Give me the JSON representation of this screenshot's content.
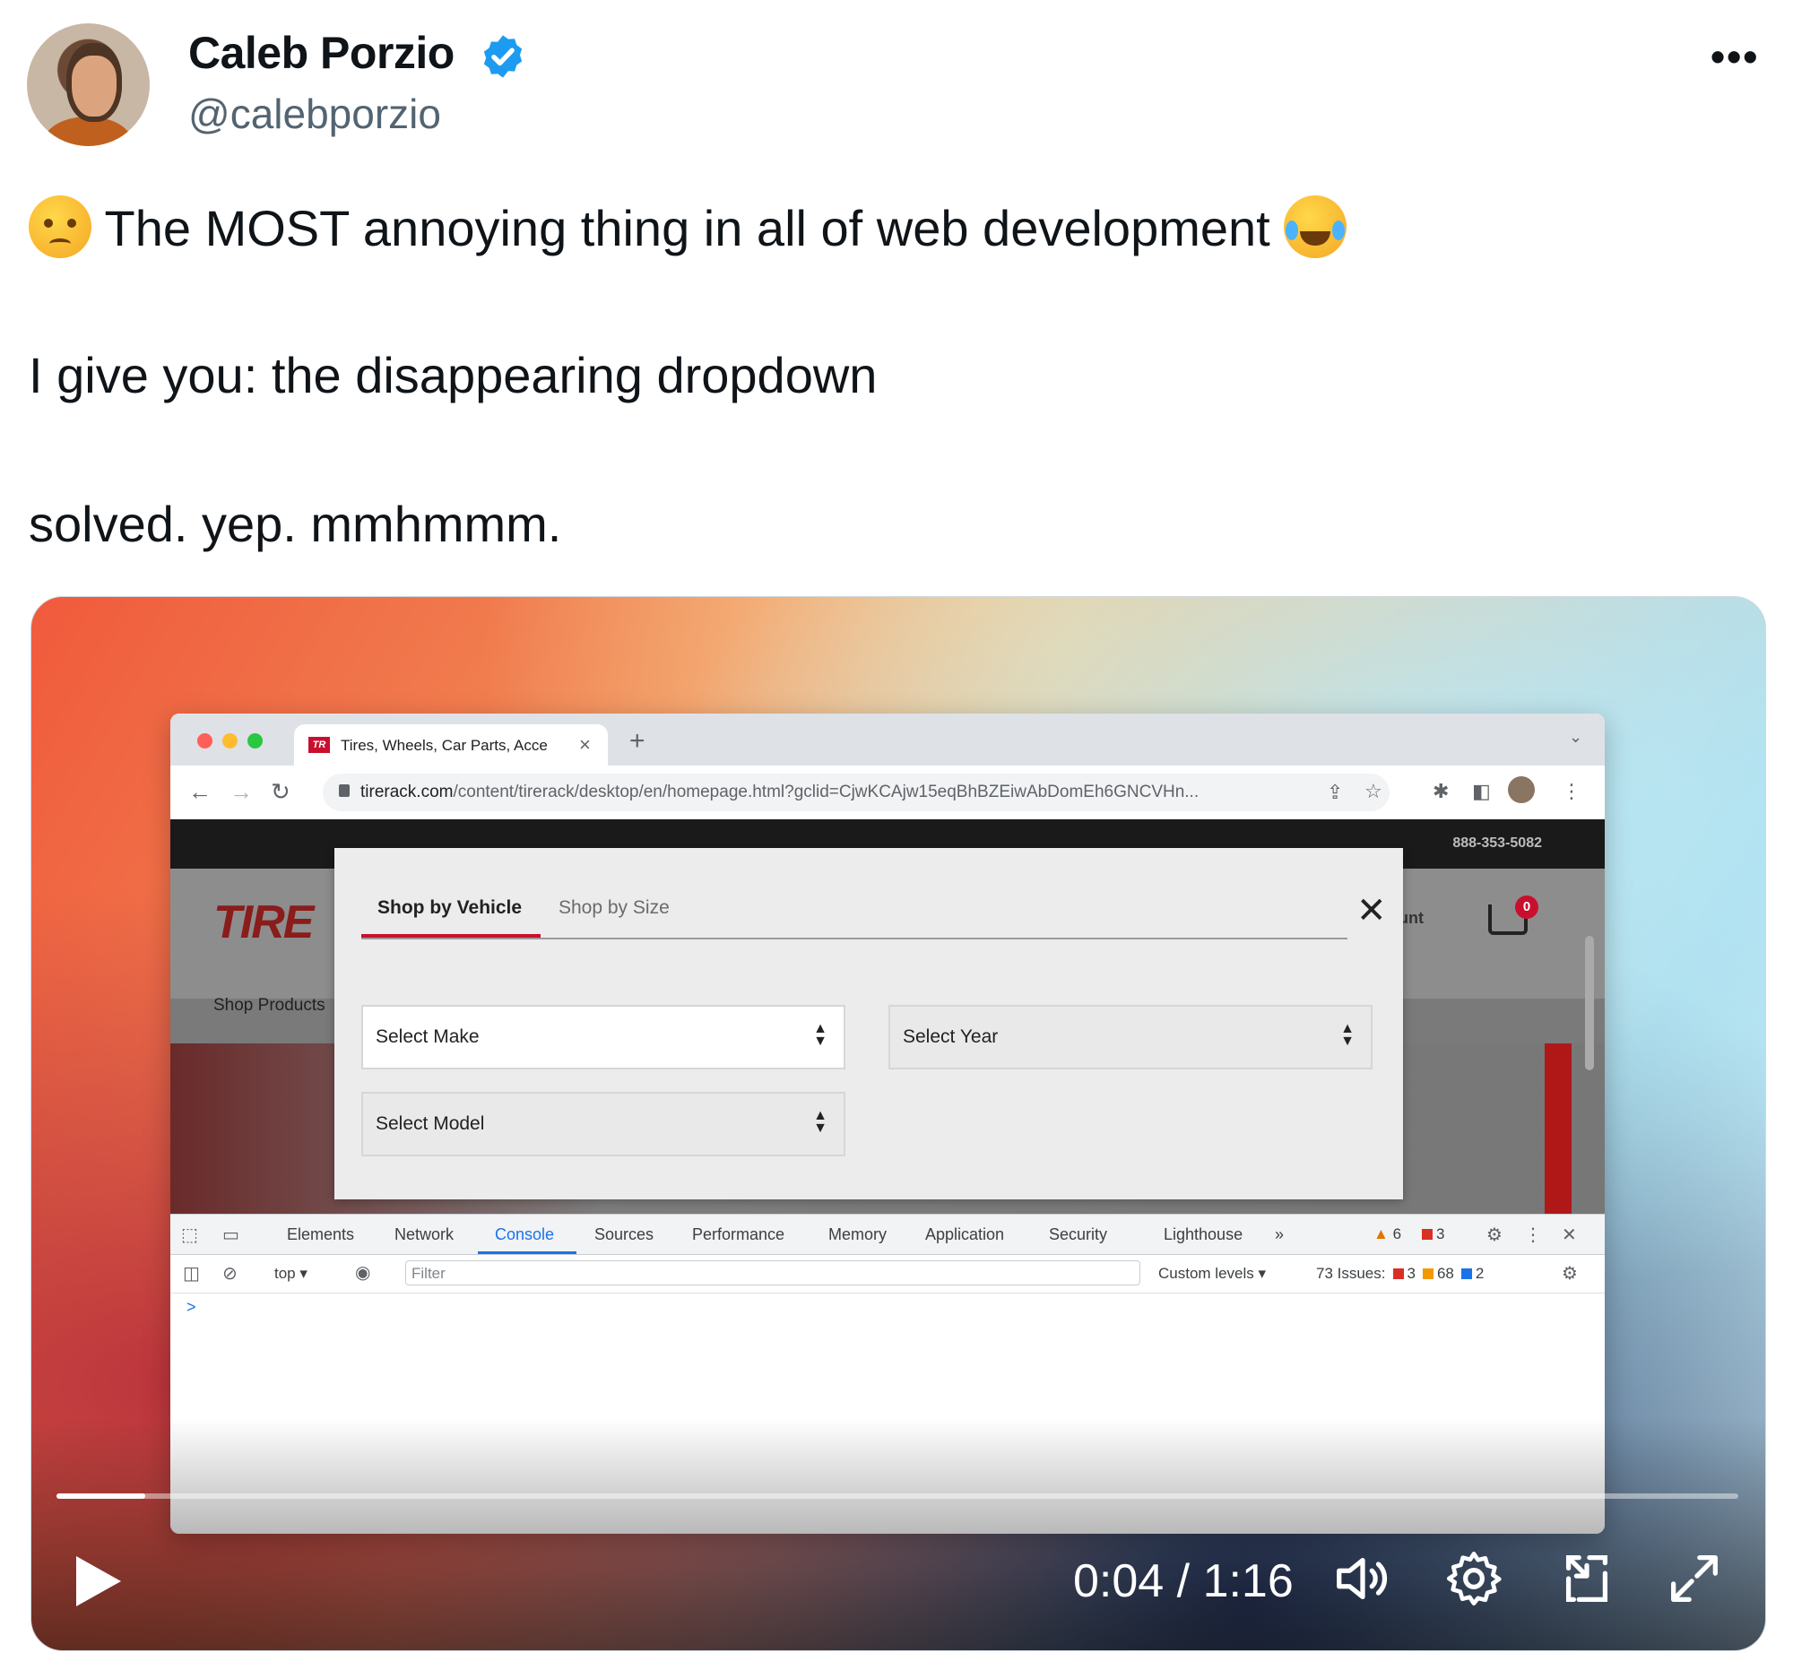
{
  "author": {
    "display_name": "Caleb Porzio",
    "handle": "@calebporzio",
    "verified": true,
    "avatar_icon": "avatar"
  },
  "more_label": "•••",
  "tweet": {
    "line1": "The MOST annoying thing in all of web development",
    "line1_emoji_start": "angry-face-emoji",
    "line1_emoji_end": "tears-of-joy-emoji",
    "line2": "I give you: the disappearing dropdown",
    "line3": "solved. yep. mmhmmm."
  },
  "video": {
    "current_time": "0:04",
    "duration": "1:16",
    "time_separator": " / ",
    "progress": 0.053,
    "controls": [
      "play-icon",
      "volume-icon",
      "settings-icon",
      "pip-icon",
      "fullscreen-icon"
    ]
  },
  "browser": {
    "tab_title": "Tires, Wheels, Car Parts, Acce",
    "favicon_text": "TR",
    "new_tab": "+",
    "url_host": "tirerack.com",
    "url_path": "/content/tirerack/desktop/en/homepage.html?gclid=CjwKCAjw15eqBhBZEiwAbDomEh6GNCVHn..."
  },
  "site": {
    "phone": "888-353-5082",
    "logo": "TIRE",
    "shop_products": "Shop Products",
    "account": "unt",
    "cart_count": "0"
  },
  "modal": {
    "tab_vehicle": "Shop by Vehicle",
    "tab_size": "Shop by Size",
    "close": "✕",
    "select_make": "Select Make",
    "select_year": "Select Year",
    "select_model": "Select Model"
  },
  "devtools": {
    "tabs": [
      "Elements",
      "Network",
      "Console",
      "Sources",
      "Performance",
      "Memory",
      "Application",
      "Security",
      "Lighthouse"
    ],
    "more_tabs": "»",
    "active_tab": "Console",
    "warnings": "6",
    "errors": "3",
    "context": "top",
    "filter_placeholder": "Filter",
    "levels": "Custom levels ▾",
    "issues_label": "73 Issues:",
    "issues_red": "3",
    "issues_orange": "68",
    "issues_blue": "2",
    "prompt": ">"
  },
  "colors": {
    "brand_red": "#c8102e",
    "devtools_blue": "#1a73e8",
    "verified_blue": "#1d9bf0",
    "handle_grey": "#536471"
  }
}
